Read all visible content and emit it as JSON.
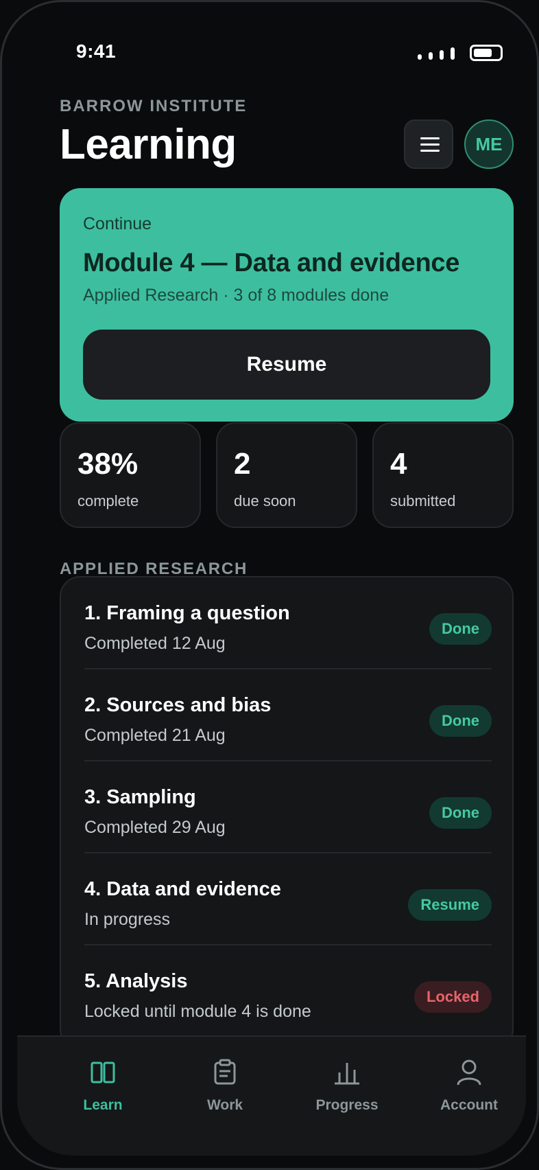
{
  "status_bar": {
    "time": "9:41"
  },
  "header": {
    "org": "BARROW INSTITUTE",
    "title": "Learning",
    "avatar_initials": "ME"
  },
  "continue_card": {
    "label": "Continue",
    "module_title": "Module 4 — Data and evidence",
    "meta": "Applied Research · 3 of 8 modules done",
    "resume_label": "Resume"
  },
  "stats": [
    {
      "value": "38%",
      "label": "complete"
    },
    {
      "value": "2",
      "label": "due soon"
    },
    {
      "value": "4",
      "label": "submitted"
    }
  ],
  "section": {
    "title": "APPLIED RESEARCH",
    "modules": [
      {
        "name": "1. Framing a question",
        "sub": "Completed 12 Aug",
        "badge": "Done",
        "badge_kind": "done"
      },
      {
        "name": "2. Sources and bias",
        "sub": "Completed 21 Aug",
        "badge": "Done",
        "badge_kind": "done"
      },
      {
        "name": "3. Sampling",
        "sub": "Completed 29 Aug",
        "badge": "Done",
        "badge_kind": "done"
      },
      {
        "name": "4. Data and evidence",
        "sub": "In progress",
        "badge": "Resume",
        "badge_kind": "resume"
      },
      {
        "name": "5. Analysis",
        "sub": "Locked until module 4 is done",
        "badge": "Locked",
        "badge_kind": "locked"
      }
    ]
  },
  "tabbar": {
    "items": [
      {
        "label": "Learn",
        "icon": "book-icon",
        "active": true
      },
      {
        "label": "Work",
        "icon": "clipboard-icon",
        "active": false
      },
      {
        "label": "Progress",
        "icon": "bar-chart-icon",
        "active": false
      },
      {
        "label": "Account",
        "icon": "user-icon",
        "active": false
      }
    ]
  },
  "colors": {
    "accent": "#3dbf9f",
    "done_badge_bg": "#123a30",
    "done_badge_text": "#45c9a4",
    "locked_badge_bg": "#3a1d20",
    "locked_badge_text": "#e8646b"
  }
}
